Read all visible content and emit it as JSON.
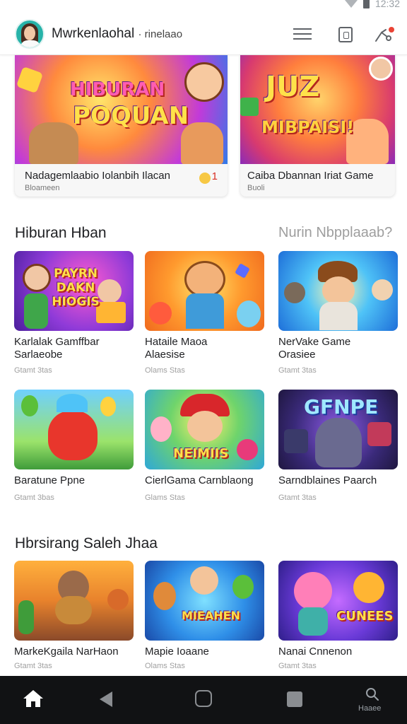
{
  "status_bar": {
    "time": "12:32"
  },
  "header": {
    "title": "Mwrkenlaohal",
    "subtitle": "· rinelaao"
  },
  "featured": [
    {
      "art_text_1": "HIBURAN",
      "art_text_2": "POQUAN",
      "title": "Nadagemlaabio Iolanbih Ilacan",
      "subtitle": "Bloameen",
      "count": "1"
    },
    {
      "art_text_1": "JUZ",
      "art_text_2": "MIBPAISI!",
      "title": "Caiba Dbannan Iriat Game",
      "subtitle": "Buoli"
    }
  ],
  "section1": {
    "title": "Hiburan Hban",
    "link": "Nurin Nbpplaaab?"
  },
  "grid1": [
    {
      "art_text": "PAYRN DAKN HIOGIS",
      "line1": "Karlalak Gamffbar",
      "line2": "Sarlaeobe",
      "meta": "Gtamt 3tas"
    },
    {
      "art_text": "",
      "line1": "Hataile Maoa",
      "line2": "Alaesise",
      "meta": "Olams Stas"
    },
    {
      "art_text": "",
      "line1": "NerVake Game",
      "line2": "Orasiee",
      "meta": "Gtamt 3tas"
    },
    {
      "art_text": "",
      "line1": "Baratune Ppne",
      "line2": "",
      "meta": "Gtamt 3bas"
    },
    {
      "art_text": "NEIMIIS",
      "line1": "CierlGama Carnblaong",
      "line2": "",
      "meta": "Glams Stas"
    },
    {
      "art_text": "GFNPE",
      "line1": "Sarndblaines Paarch",
      "line2": "",
      "meta": "Gtamt 3tas"
    }
  ],
  "section2": {
    "title": "Hbrsirang Saleh Jhaa"
  },
  "grid2": [
    {
      "art_text": "",
      "line1": "MarkeKgaila NarHaon",
      "meta": "Gtamt 3tas"
    },
    {
      "art_text": "MIEAHEN",
      "line1": "Mapie Ioaane",
      "meta": "Olams Stas"
    },
    {
      "art_text": "CUNEES",
      "line1": "Nanai Cnnenon",
      "meta": "Gtamt 3tas"
    }
  ],
  "bottom_nav": {
    "search_label": "Haaee"
  }
}
